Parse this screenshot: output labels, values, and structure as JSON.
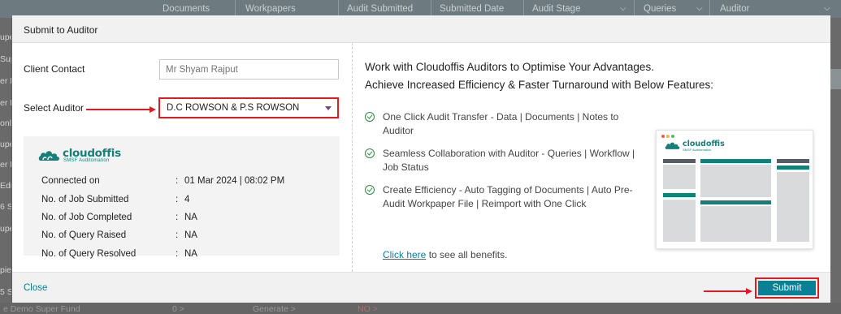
{
  "background": {
    "columns": [
      "Documents",
      "Workpapers",
      "Audit Submitted",
      "Submitted Date",
      "Audit Stage",
      "Queries",
      "Auditor"
    ],
    "left_fragments": [
      "uper",
      "Supe",
      "er F",
      "er F",
      "onl",
      "upe",
      "er F",
      "Edit",
      "6 S",
      "upe",
      "piec",
      "5 S"
    ],
    "bottom_row": [
      "e Demo Super Fund",
      "0 >",
      "Generate >",
      "NO >"
    ]
  },
  "modal": {
    "title": "Submit to Auditor",
    "client_contact": {
      "label": "Client Contact",
      "placeholder": "Mr Shyam Rajput"
    },
    "select_auditor": {
      "label": "Select Auditor",
      "value": "D.C ROWSON & P.S ROWSON"
    },
    "info": {
      "logo_name": "cloudoffis",
      "logo_tagline": "SMSF Auditomation",
      "rows": [
        {
          "key": "Connected on",
          "colon": ":",
          "value": "01 Mar 2024 | 08:02 PM"
        },
        {
          "key": "No. of Job Submitted",
          "colon": ":",
          "value": "4"
        },
        {
          "key": "No. of Job Completed",
          "colon": ":",
          "value": "NA"
        },
        {
          "key": "No. of Query Raised",
          "colon": ":",
          "value": "NA"
        },
        {
          "key": "No. of Query Resolved",
          "colon": ":",
          "value": "NA"
        }
      ]
    },
    "promo": {
      "line1": "Work with Cloudoffis Auditors to Optimise Your Advantages.",
      "line2": "Achieve Increased Efficiency & Faster Turnaround with Below Features:",
      "features": [
        "One Click Audit Transfer - Data | Documents | Notes to Auditor",
        "Seamless Collaboration with Auditor - Queries | Workflow | Job Status",
        "Create Efficiency - Auto Tagging of Documents | Auto Pre-Audit Workpaper File | Reimport with One Click"
      ],
      "benefits_link": "Click here",
      "benefits_text": " to see all benefits."
    },
    "footer": {
      "close_label": "Close",
      "submit_label": "Submit"
    }
  },
  "colors": {
    "accent": "#0a7f96",
    "brand": "#14807a",
    "highlight": "#e11b22",
    "check": "#2e8b3e"
  }
}
